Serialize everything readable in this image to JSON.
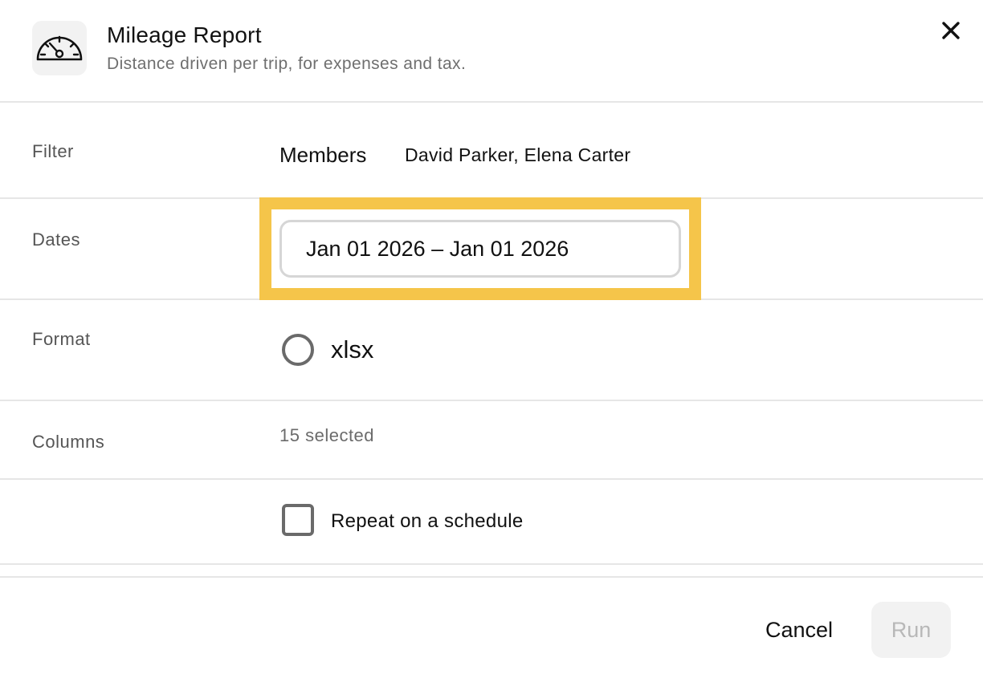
{
  "header": {
    "icon": "speedometer-icon",
    "title": "Mileage Report",
    "subtitle": "Distance driven per trip, for expenses and tax.",
    "close_icon": "close-icon"
  },
  "filter": {
    "label": "Filter",
    "key": "Members",
    "value": "David Parker, Elena Carter"
  },
  "dates": {
    "label": "Dates",
    "value": "Jan 01 2026 – Jan 01 2026",
    "highlight_color": "#f5c54a"
  },
  "format": {
    "label": "Format",
    "option": "xlsx"
  },
  "columns": {
    "label": "Columns",
    "value": "15 selected"
  },
  "schedule": {
    "label": "Repeat on a schedule"
  },
  "footer": {
    "cancel_label": "Cancel",
    "run_label": "Run"
  }
}
